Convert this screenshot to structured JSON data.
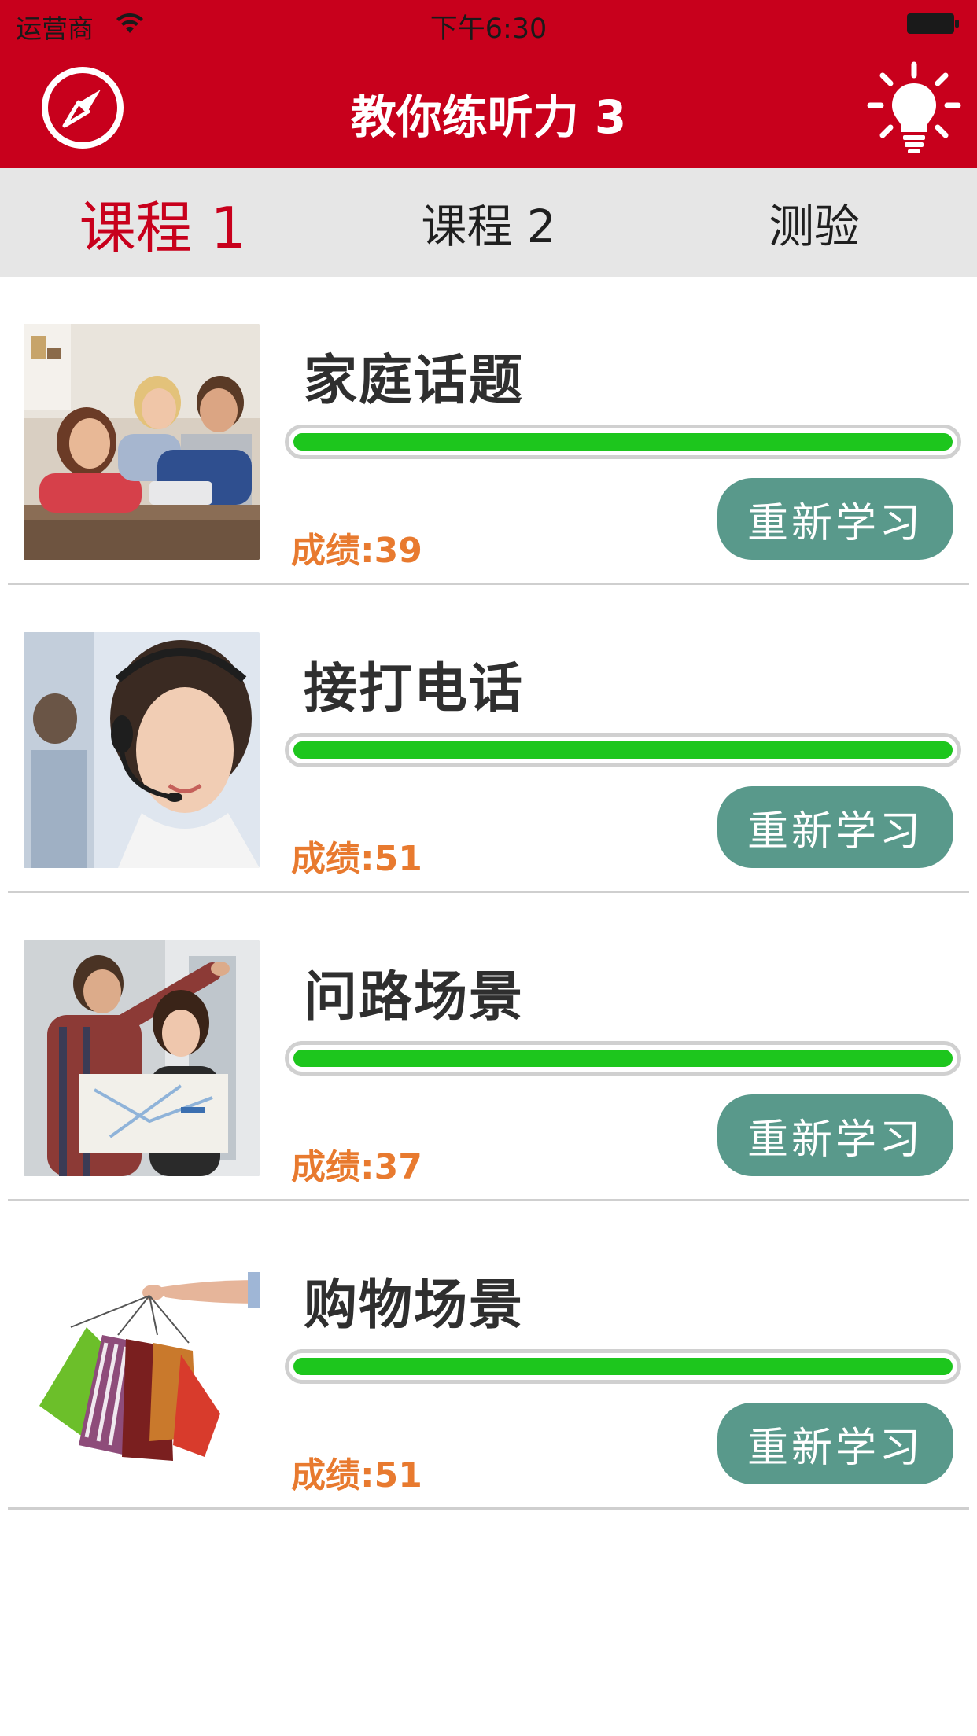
{
  "status_bar": {
    "carrier": "运营商",
    "time": "下午6:30"
  },
  "nav": {
    "title": "教你练听力 3",
    "left_icon": "compass-icon",
    "right_icon": "lightbulb-icon"
  },
  "tabs": [
    {
      "label": "课程 1",
      "active": true
    },
    {
      "label": "课程 2",
      "active": false
    },
    {
      "label": "测验",
      "active": false
    }
  ],
  "lessons": [
    {
      "title": "家庭话题",
      "score": "成绩:39",
      "button": "重新学习",
      "progress": 1.0,
      "image": "family-photo"
    },
    {
      "title": "接打电话",
      "score": "成绩:51",
      "button": "重新学习",
      "progress": 1.0,
      "image": "call-center-photo"
    },
    {
      "title": "问路场景",
      "score": "成绩:37",
      "button": "重新学习",
      "progress": 1.0,
      "image": "asking-directions-photo"
    },
    {
      "title": "购物场景",
      "score": "成绩:51",
      "button": "重新学习",
      "progress": 1.0,
      "image": "shopping-bags-photo"
    }
  ],
  "colors": {
    "brand_red": "#c8001c",
    "progress_green": "#1dc61d",
    "score_orange": "#e87a2f",
    "button_teal": "#59998b"
  }
}
